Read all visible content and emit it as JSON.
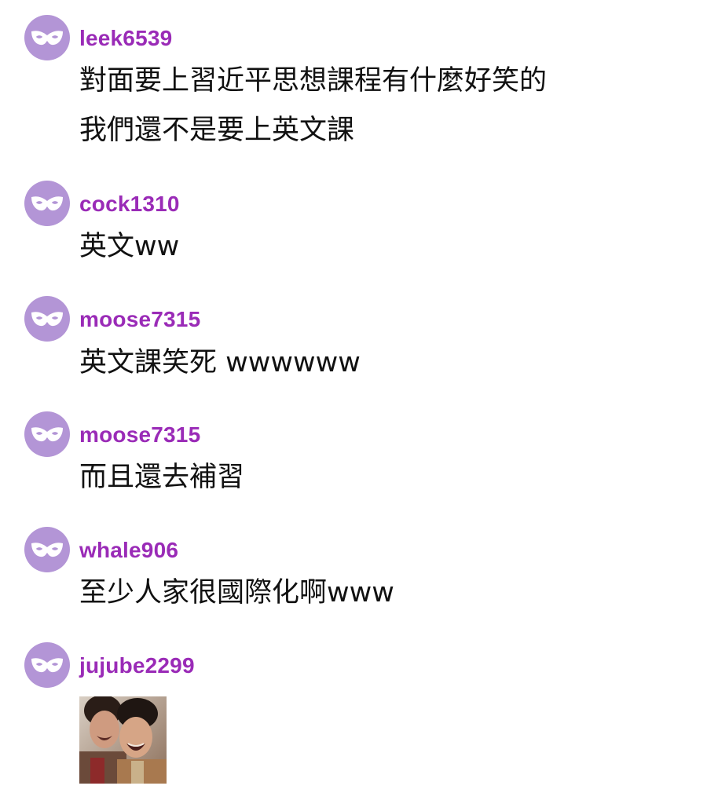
{
  "colors": {
    "avatar_bg": "#b395d6",
    "username": "#9a2bb7",
    "text": "#111111"
  },
  "avatar_icon": "mask-icon",
  "comments": [
    {
      "username": "leek6539",
      "lines": [
        "對面要上習近平思想課程有什麼好笑的",
        "我們還不是要上英文課"
      ]
    },
    {
      "username": "cock1310",
      "lines": [
        "英文ww"
      ]
    },
    {
      "username": "moose7315",
      "lines": [
        "英文課笑死 wwwwww"
      ]
    },
    {
      "username": "moose7315",
      "lines": [
        "而且還去補習"
      ]
    },
    {
      "username": "whale906",
      "lines": [
        "至少人家很國際化啊www"
      ]
    },
    {
      "username": "jujube2299",
      "sticker": "laughing-people-sticker"
    }
  ]
}
